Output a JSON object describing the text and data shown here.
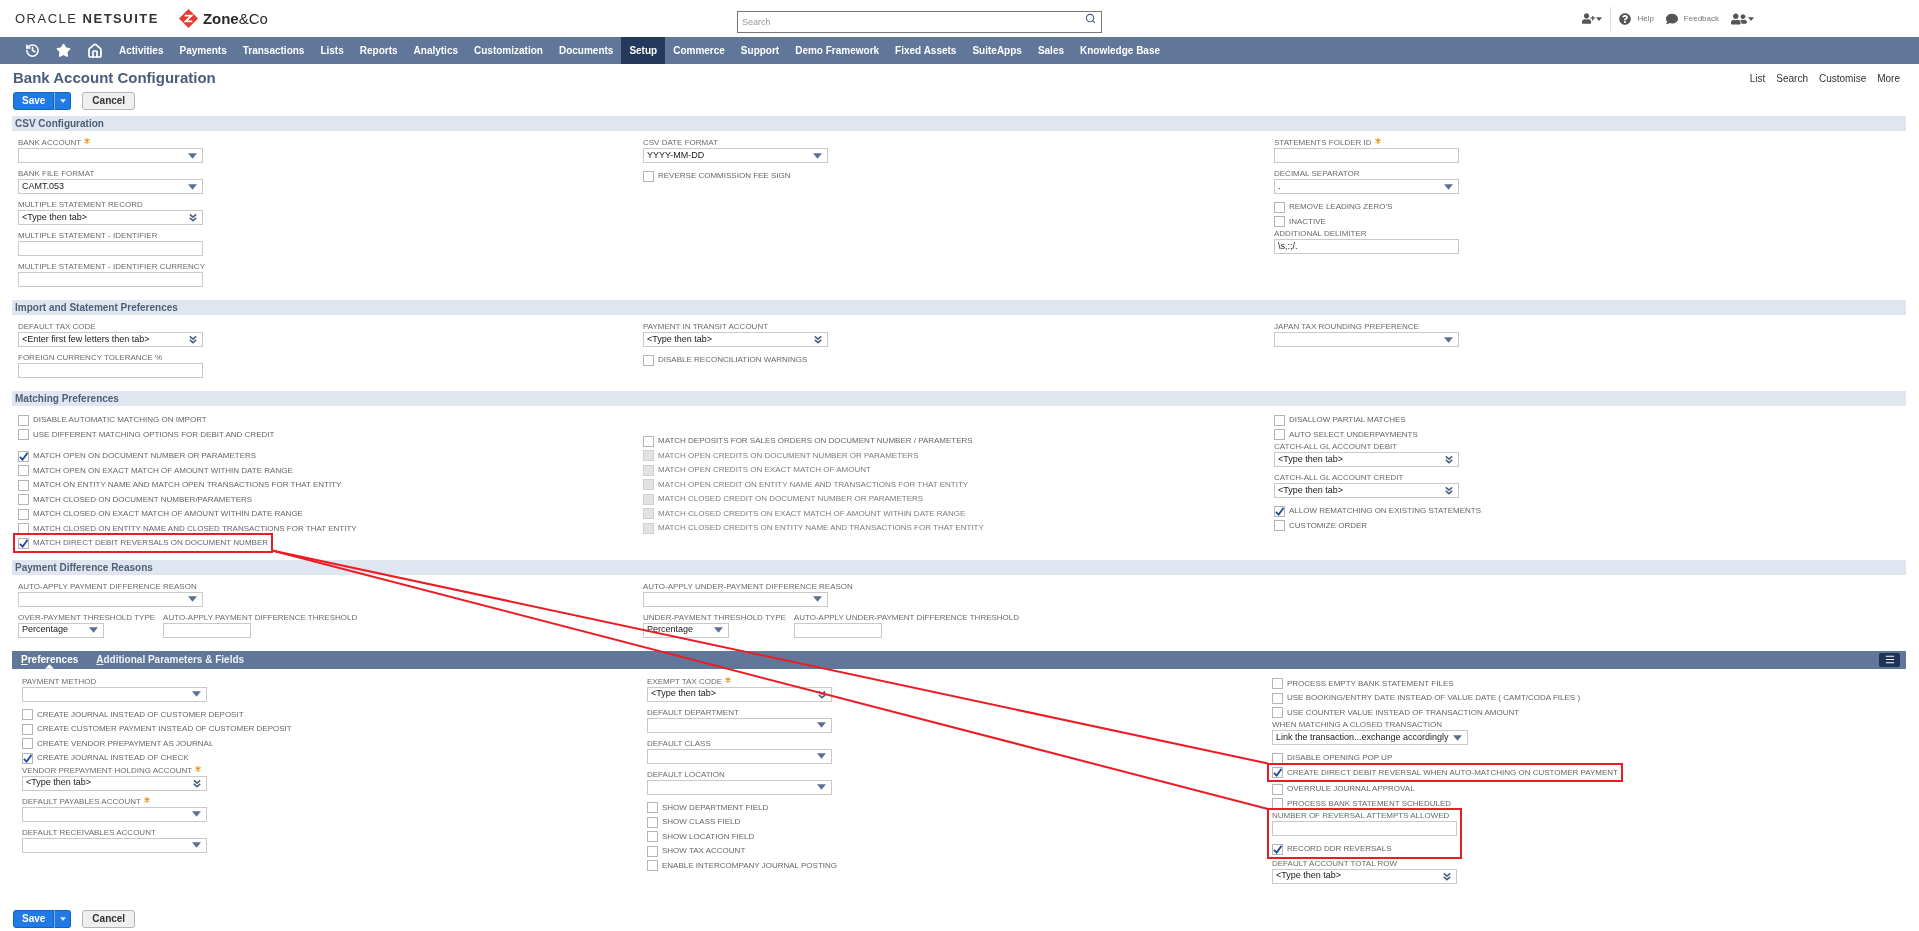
{
  "header": {
    "logo": "ORACLE **NETSUITE**",
    "partner_logo": "**Zone**&Co",
    "search": {
      "placeholder": "Search"
    },
    "links": [
      {
        "kind": "help",
        "label": "Help"
      },
      {
        "kind": "feedback",
        "label": "Feedback"
      }
    ]
  },
  "nav": [
    {
      "label": "Activities",
      "selected": false
    },
    {
      "label": "Payments",
      "selected": false
    },
    {
      "label": "Transactions",
      "selected": false
    },
    {
      "label": "Lists",
      "selected": false
    },
    {
      "label": "Reports",
      "selected": false
    },
    {
      "label": "Analytics",
      "selected": false
    },
    {
      "label": "Customization",
      "selected": false
    },
    {
      "label": "Documents",
      "selected": false
    },
    {
      "label": "Setup",
      "selected": true
    },
    {
      "label": "Commerce",
      "selected": false
    },
    {
      "label": "Support",
      "selected": false
    },
    {
      "label": "Demo Framework",
      "selected": false
    },
    {
      "label": "Fixed Assets",
      "selected": false
    },
    {
      "label": "SuiteApps",
      "selected": false
    },
    {
      "label": "Sales",
      "selected": false
    },
    {
      "label": "Knowledge Base",
      "selected": false
    }
  ],
  "page": {
    "title": "Bank Account Configuration",
    "links": [
      "List",
      "Search",
      "Customise",
      "More"
    ]
  },
  "buttons": [
    {
      "kind": "primary",
      "label": "Save"
    },
    {
      "kind": "secondary",
      "label": "Cancel"
    }
  ],
  "sections": [
    {
      "title": "CSV Configuration",
      "columns": [
        [
          {
            "kind": "select",
            "label": "BANK ACCOUNT",
            "required": true
          },
          {
            "kind": "select",
            "label": "BANK FILE FORMAT",
            "required": false,
            "value": "CAMT.053"
          },
          {
            "kind": "lookup",
            "label": "MULTIPLE STATEMENT RECORD",
            "required": false,
            "value": "<Type then tab>"
          },
          {
            "kind": "text",
            "label": "MULTIPLE STATEMENT - IDENTIFIER",
            "required": false
          },
          {
            "kind": "text",
            "label": "MULTIPLE STATEMENT - IDENTIFIER CURRENCY",
            "required": false
          }
        ],
        [
          {
            "kind": "select",
            "label": "CSV DATE FORMAT",
            "required": false,
            "value": "YYYY-MM-DD"
          },
          {
            "kind": "checkbox",
            "label": "REVERSE COMMISSION FEE SIGN",
            "checked": false
          }
        ],
        [
          {
            "kind": "text",
            "label": "STATEMENTS FOLDER ID",
            "required": true
          },
          {
            "kind": "select",
            "label": "DECIMAL SEPARATOR",
            "required": false,
            "value": "."
          },
          {
            "kind": "checkbox",
            "label": "REMOVE LEADING ZERO'S",
            "checked": false
          },
          {
            "kind": "checkbox",
            "label": "INACTIVE",
            "checked": false
          },
          {
            "kind": "text",
            "label": "ADDITIONAL DELIMITER",
            "required": false,
            "value": "\\s,:;/."
          }
        ]
      ]
    },
    {
      "title": "Import and Statement Preferences",
      "columns": [
        [
          {
            "kind": "lookup",
            "label": "DEFAULT TAX CODE",
            "required": false,
            "value": "<Enter first few letters then tab>"
          },
          {
            "kind": "text",
            "label": "FOREIGN CURRENCY TOLERANCE %",
            "required": false
          }
        ],
        [
          {
            "kind": "lookup",
            "label": "PAYMENT IN TRANSIT ACCOUNT",
            "required": false,
            "value": "<Type then tab>"
          },
          {
            "kind": "checkbox",
            "label": "DISABLE RECONCILIATION WARNINGS",
            "checked": false
          }
        ],
        [
          {
            "kind": "select",
            "label": "JAPAN TAX ROUNDING PREFERENCE",
            "required": false
          }
        ]
      ]
    },
    {
      "title": "Matching Preferences",
      "columns": [
        [
          {
            "kind": "checkbox",
            "label": "DISABLE AUTOMATIC MATCHING ON IMPORT",
            "checked": false,
            "highlighted": false
          },
          {
            "kind": "checkbox",
            "label": "USE DIFFERENT MATCHING OPTIONS FOR DEBIT AND CREDIT",
            "checked": false,
            "highlighted": false
          },
          {
            "kind": "checkbox",
            "label": "MATCH OPEN ON DOCUMENT NUMBER OR PARAMETERS",
            "checked": true,
            "highlighted": false
          },
          {
            "kind": "checkbox",
            "label": "MATCH OPEN ON EXACT MATCH OF AMOUNT WITHIN DATE RANGE",
            "checked": false,
            "highlighted": false
          },
          {
            "kind": "checkbox",
            "label": "MATCH ON ENTITY NAME AND MATCH OPEN TRANSACTIONS FOR THAT ENTITY",
            "checked": false,
            "highlighted": false
          },
          {
            "kind": "checkbox",
            "label": "MATCH CLOSED ON DOCUMENT NUMBER/PARAMETERS",
            "checked": false,
            "highlighted": false
          },
          {
            "kind": "checkbox",
            "label": "MATCH CLOSED ON EXACT MATCH OF AMOUNT WITHIN DATE RANGE",
            "checked": false,
            "highlighted": false
          },
          {
            "kind": "checkbox",
            "label": "MATCH CLOSED ON ENTITY NAME AND CLOSED TRANSACTIONS FOR THAT ENTITY",
            "checked": false,
            "highlighted": false
          },
          {
            "kind": "checkbox",
            "label": "MATCH DIRECT DEBIT REVERSALS ON DOCUMENT NUMBER",
            "checked": true,
            "highlighted": true
          }
        ],
        [
          {
            "kind": "checkbox",
            "label": "MATCH DEPOSITS FOR SALES ORDERS ON DOCUMENT NUMBER / PARAMETERS",
            "checked": false,
            "disabled": false
          },
          {
            "kind": "checkbox",
            "label": "MATCH OPEN CREDITS ON DOCUMENT NUMBER OR PARAMETERS",
            "checked": false,
            "disabled": true
          },
          {
            "kind": "checkbox",
            "label": "MATCH OPEN CREDITS ON EXACT MATCH OF AMOUNT",
            "checked": false,
            "disabled": true
          },
          {
            "kind": "checkbox",
            "label": "MATCH OPEN CREDIT ON ENTITY NAME AND TRANSACTIONS FOR THAT ENTITY",
            "checked": false,
            "disabled": true
          },
          {
            "kind": "checkbox",
            "label": "MATCH CLOSED CREDIT ON DOCUMENT NUMBER OR PARAMETERS",
            "checked": false,
            "disabled": true
          },
          {
            "kind": "checkbox",
            "label": "MATCH CLOSED CREDITS ON EXACT MATCH OF AMOUNT WITHIN DATE RANGE",
            "checked": false,
            "disabled": true
          },
          {
            "kind": "checkbox",
            "label": "MATCH CLOSED CREDITS ON ENTITY NAME AND TRANSACTIONS FOR THAT ENTITY",
            "checked": false,
            "disabled": true
          }
        ],
        [
          {
            "kind": "checkbox",
            "label": "DISALLOW PARTIAL MATCHES",
            "checked": false
          },
          {
            "kind": "checkbox",
            "label": "AUTO SELECT UNDERPAYMENTS",
            "checked": false
          },
          {
            "kind": "lookup",
            "label": "CATCH-ALL GL ACCOUNT DEBIT",
            "required": false,
            "value": "<Type then tab>"
          },
          {
            "kind": "lookup",
            "label": "CATCH-ALL GL ACCOUNT CREDIT",
            "required": false,
            "value": "<Type then tab>"
          },
          {
            "kind": "checkbox",
            "label": "ALLOW REMATCHING ON EXISTING STATEMENTS",
            "checked": true
          },
          {
            "kind": "checkbox",
            "label": "CUSTOMIZE ORDER",
            "checked": false
          }
        ]
      ]
    },
    {
      "title": "Payment Difference Reasons",
      "columns": [
        [
          {
            "kind": "select",
            "label": "AUTO-APPLY PAYMENT DIFFERENCE REASON",
            "required": false
          },
          {
            "kind": "field_row",
            "fields": [
              {
                "kind": "select",
                "label": "OVER-PAYMENT THRESHOLD TYPE",
                "required": false,
                "value": "Percentage"
              },
              {
                "kind": "text",
                "label": "AUTO-APPLY PAYMENT DIFFERENCE THRESHOLD",
                "required": false
              }
            ]
          }
        ],
        [
          {
            "kind": "select",
            "label": "AUTO-APPLY UNDER-PAYMENT DIFFERENCE REASON",
            "required": false
          },
          {
            "kind": "field_row",
            "fields": [
              {
                "kind": "select",
                "label": "UNDER-PAYMENT THRESHOLD TYPE",
                "required": false,
                "value": "Percentage"
              },
              {
                "kind": "text",
                "label": "AUTO-APPLY UNDER-PAYMENT DIFFERENCE THRESHOLD",
                "required": false
              }
            ]
          }
        ]
      ]
    }
  ],
  "tabs": [
    {
      "label": "Preferences",
      "selected": true
    },
    {
      "label": "Additional Parameters & Fields",
      "selected": false
    }
  ],
  "tab_content": {
    "columns": [
      [
        {
          "kind": "select",
          "label": "PAYMENT METHOD",
          "required": false
        },
        {
          "kind": "checkbox",
          "label": "CREATE JOURNAL INSTEAD OF CUSTOMER DEPOSIT",
          "checked": false
        },
        {
          "kind": "checkbox",
          "label": "CREATE CUSTOMER PAYMENT INSTEAD OF CUSTOMER DEPOSIT",
          "checked": false
        },
        {
          "kind": "checkbox",
          "label": "CREATE VENDOR PREPAYMENT AS JOURNAL",
          "checked": false
        },
        {
          "kind": "checkbox",
          "label": "CREATE JOURNAL INSTEAD OF CHECK",
          "checked": true
        },
        {
          "kind": "lookup",
          "label": "VENDOR PREPAYMENT HOLDING ACCOUNT",
          "required": true,
          "value": "<Type then tab>"
        },
        {
          "kind": "select",
          "label": "DEFAULT PAYABLES ACCOUNT",
          "required": true
        },
        {
          "kind": "select",
          "label": "DEFAULT RECEIVABLES ACCOUNT",
          "required": false
        }
      ],
      [
        {
          "kind": "lookup",
          "label": "EXEMPT TAX CODE",
          "required": true,
          "value": "<Type then tab>"
        },
        {
          "kind": "select",
          "label": "DEFAULT DEPARTMENT",
          "required": false
        },
        {
          "kind": "select",
          "label": "DEFAULT CLASS",
          "required": false
        },
        {
          "kind": "select",
          "label": "DEFAULT LOCATION",
          "required": false
        },
        {
          "kind": "checkbox",
          "label": "SHOW DEPARTMENT FIELD",
          "checked": false
        },
        {
          "kind": "checkbox",
          "label": "SHOW CLASS FIELD",
          "checked": false
        },
        {
          "kind": "checkbox",
          "label": "SHOW LOCATION FIELD",
          "checked": false
        },
        {
          "kind": "checkbox",
          "label": "SHOW TAX ACCOUNT",
          "checked": false
        },
        {
          "kind": "checkbox",
          "label": "ENABLE INTERCOMPANY JOURNAL POSTING",
          "checked": false
        }
      ],
      [
        {
          "kind": "checkbox",
          "label": "PROCESS EMPTY BANK STATEMENT FILES",
          "checked": false,
          "highlighted": false
        },
        {
          "kind": "checkbox",
          "label": "USE BOOKING/ENTRY DATE INSTEAD OF VALUE DATE ( CAMT/CODA FILES )",
          "checked": false,
          "highlighted": false
        },
        {
          "kind": "checkbox",
          "label": "USE COUNTER VALUE INSTEAD OF TRANSACTION AMOUNT",
          "checked": false,
          "highlighted": false
        },
        {
          "kind": "select",
          "label": "WHEN MATCHING A CLOSED TRANSACTION",
          "required": false,
          "value": "Link the transaction...exchange accordingly",
          "highlighted": false
        },
        {
          "kind": "checkbox",
          "label": "DISABLE OPENING POP UP",
          "checked": false,
          "highlighted": false
        },
        {
          "kind": "checkbox",
          "label": "CREATE DIRECT DEBIT REVERSAL WHEN AUTO-MATCHING ON CUSTOMER PAYMENT",
          "checked": true,
          "highlighted": true
        },
        {
          "kind": "checkbox",
          "label": "OVERRULE JOURNAL APPROVAL",
          "checked": false,
          "highlighted": false
        },
        {
          "kind": "checkbox",
          "label": "PROCESS BANK STATEMENT SCHEDULED",
          "checked": false,
          "highlighted": false
        },
        {
          "kind": "text",
          "label": "NUMBER OF REVERSAL ATTEMPTS ALLOWED",
          "required": false,
          "highlighted": true
        },
        {
          "kind": "checkbox",
          "label": "RECORD DDR REVERSALS",
          "checked": true,
          "highlighted": true
        },
        {
          "kind": "lookup",
          "label": "DEFAULT ACCOUNT TOTAL ROW",
          "required": false,
          "value": "<Type then tab>",
          "highlighted": false
        }
      ]
    ]
  },
  "footer_buttons": [
    {
      "kind": "primary",
      "label": "Save"
    },
    {
      "kind": "secondary",
      "label": "Cancel"
    }
  ]
}
